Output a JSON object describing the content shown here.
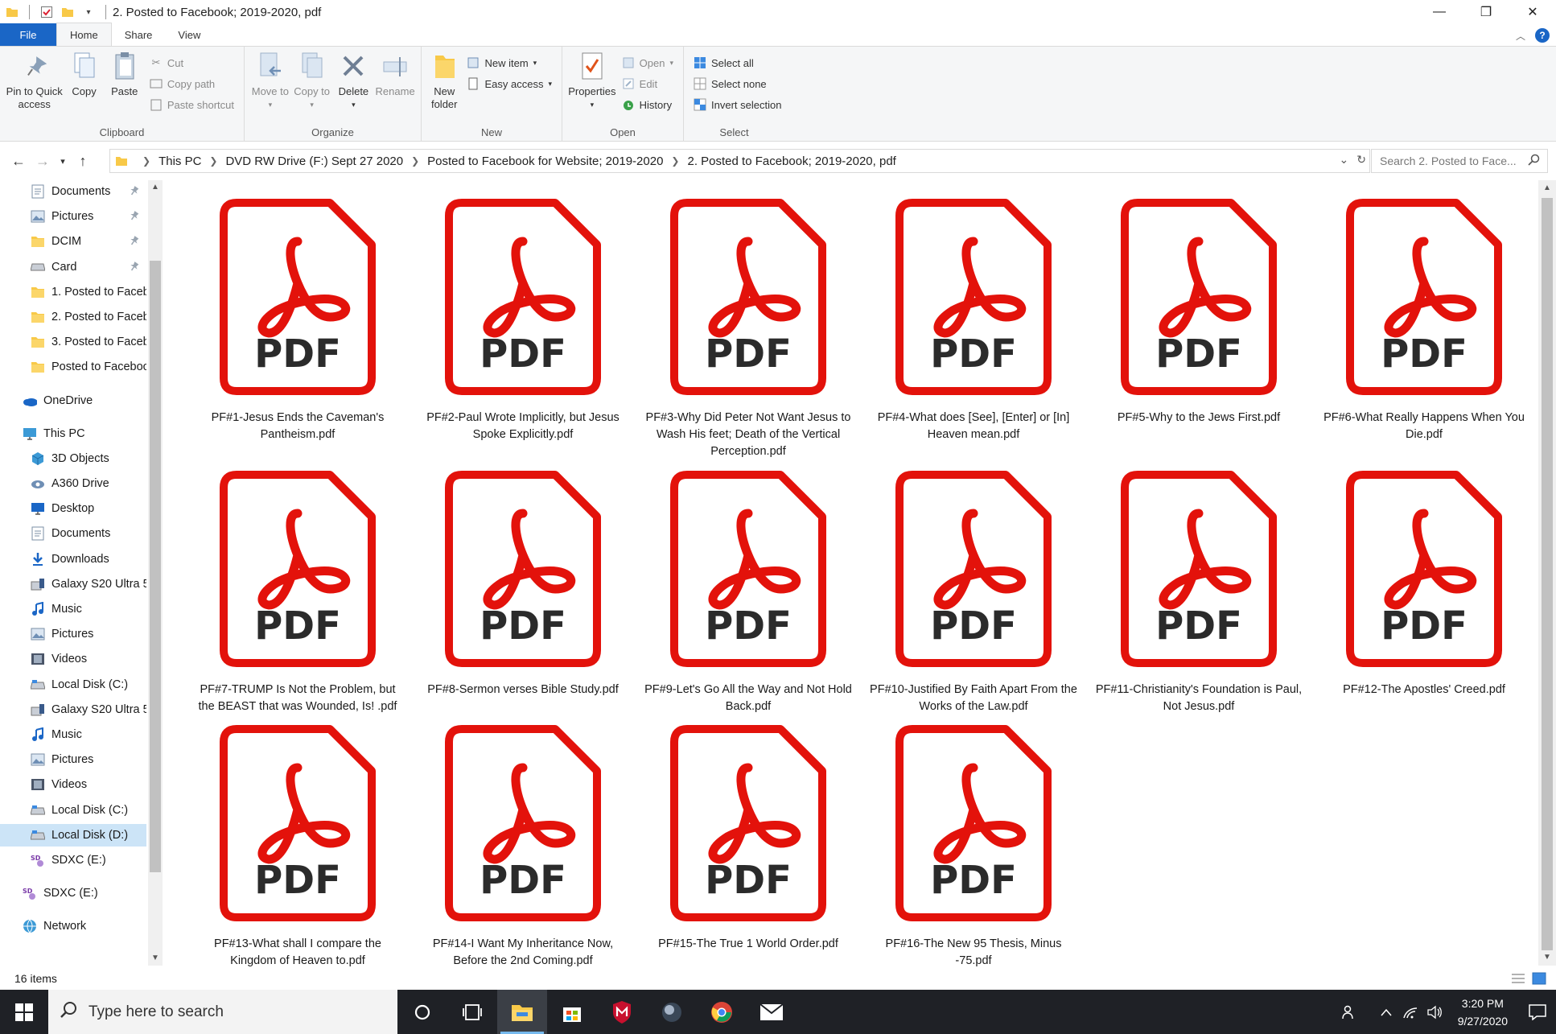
{
  "window": {
    "title": "2. Posted to Facebook; 2019-2020, pdf",
    "minimize": "—",
    "restore": "❐",
    "close": "✕"
  },
  "tabs": {
    "file": "File",
    "home": "Home",
    "share": "Share",
    "view": "View",
    "help": "?"
  },
  "ribbon": {
    "clipboard": {
      "label": "Clipboard",
      "pin": "Pin to Quick access",
      "copy": "Copy",
      "paste": "Paste",
      "cut": "Cut",
      "copy_path": "Copy path",
      "paste_shortcut": "Paste shortcut"
    },
    "organize": {
      "label": "Organize",
      "move_to": "Move to",
      "copy_to": "Copy to",
      "delete": "Delete",
      "rename": "Rename"
    },
    "new": {
      "label": "New",
      "new_folder": "New folder",
      "new_item": "New item",
      "easy_access": "Easy access"
    },
    "open": {
      "label": "Open",
      "properties": "Properties",
      "open": "Open",
      "edit": "Edit",
      "history": "History"
    },
    "select": {
      "label": "Select",
      "select_all": "Select all",
      "select_none": "Select none",
      "invert": "Invert selection"
    }
  },
  "address": {
    "crumbs": [
      "This PC",
      "DVD RW Drive (F:) Sept 27 2020",
      "Posted to Facebook for Website; 2019-2020",
      "2. Posted to Facebook; 2019-2020, pdf"
    ],
    "search_placeholder": "Search 2. Posted to Face..."
  },
  "nav": {
    "quick": [
      {
        "label": "Documents",
        "icon": "documents-icon",
        "pinned": true
      },
      {
        "label": "Pictures",
        "icon": "pictures-icon",
        "pinned": true
      },
      {
        "label": "DCIM",
        "icon": "folder-icon",
        "pinned": true
      },
      {
        "label": "Card",
        "icon": "drive-icon",
        "pinned": true
      },
      {
        "label": "1. Posted to Faceb",
        "icon": "folder-icon",
        "pinned": false
      },
      {
        "label": "2. Posted to Faceb",
        "icon": "folder-icon",
        "pinned": false
      },
      {
        "label": "3. Posted to Faceb",
        "icon": "folder-icon",
        "pinned": false
      },
      {
        "label": "Posted to Faceboo",
        "icon": "folder-icon",
        "pinned": false
      }
    ],
    "onedrive": "OneDrive",
    "thispc": "This PC",
    "pc_items": [
      {
        "label": "3D Objects",
        "icon": "3d-objects-icon"
      },
      {
        "label": "A360 Drive",
        "icon": "cloud-drive-icon"
      },
      {
        "label": "Desktop",
        "icon": "desktop-icon"
      },
      {
        "label": "Documents",
        "icon": "documents-icon"
      },
      {
        "label": "Downloads",
        "icon": "downloads-icon"
      },
      {
        "label": "Galaxy S20 Ultra 5",
        "icon": "phone-icon"
      },
      {
        "label": "Music",
        "icon": "music-icon"
      },
      {
        "label": "Pictures",
        "icon": "pictures-icon"
      },
      {
        "label": "Videos",
        "icon": "videos-icon"
      },
      {
        "label": "Local Disk (C:)",
        "icon": "disk-icon"
      },
      {
        "label": "Galaxy S20 Ultra 5",
        "icon": "phone-icon"
      },
      {
        "label": "Music",
        "icon": "music-icon"
      },
      {
        "label": "Pictures",
        "icon": "pictures-icon"
      },
      {
        "label": "Videos",
        "icon": "videos-icon"
      },
      {
        "label": "Local Disk (C:)",
        "icon": "disk-icon"
      },
      {
        "label": "Local Disk (D:)",
        "icon": "disk-icon"
      },
      {
        "label": "SDXC (E:)",
        "icon": "sd-card-icon"
      }
    ],
    "sdxc": "SDXC (E:)",
    "network": "Network"
  },
  "files": [
    {
      "name": "PF#1-Jesus Ends the Caveman's Pantheism.pdf"
    },
    {
      "name": "PF#2-Paul Wrote Implicitly, but Jesus Spoke Explicitly.pdf"
    },
    {
      "name": "PF#3-Why Did Peter Not Want Jesus to Wash His feet; Death of the Vertical Perception.pdf"
    },
    {
      "name": "PF#4-What does [See], [Enter] or [In] Heaven mean.pdf"
    },
    {
      "name": "PF#5-Why to the Jews First.pdf"
    },
    {
      "name": "PF#6-What Really Happens When You Die.pdf"
    },
    {
      "name": "PF#7-TRUMP Is Not the Problem, but the BEAST that was Wounded, Is! .pdf"
    },
    {
      "name": "PF#8-Sermon verses Bible Study.pdf"
    },
    {
      "name": "PF#9-Let's Go All the Way and Not Hold Back.pdf"
    },
    {
      "name": "PF#10-Justified By Faith Apart From the Works of the Law.pdf"
    },
    {
      "name": "PF#11-Christianity's Foundation is Paul, Not Jesus.pdf"
    },
    {
      "name": "PF#12-The Apostles' Creed.pdf"
    },
    {
      "name": "PF#13-What shall I compare the Kingdom of Heaven to.pdf"
    },
    {
      "name": "PF#14-I Want My Inheritance Now, Before the 2nd Coming.pdf"
    },
    {
      "name": "PF#15-The True 1 World Order.pdf"
    },
    {
      "name": "PF#16-The New 95 Thesis, Minus -75.pdf"
    }
  ],
  "pdf_label": "PDF",
  "status": {
    "count": "16 items"
  },
  "taskbar": {
    "search_placeholder": "Type here to search",
    "time": "3:20 PM",
    "date": "9/27/2020"
  },
  "colors": {
    "accent": "#1a66c6",
    "pdf_red": "#e3120b",
    "taskbar": "#1f2126"
  }
}
